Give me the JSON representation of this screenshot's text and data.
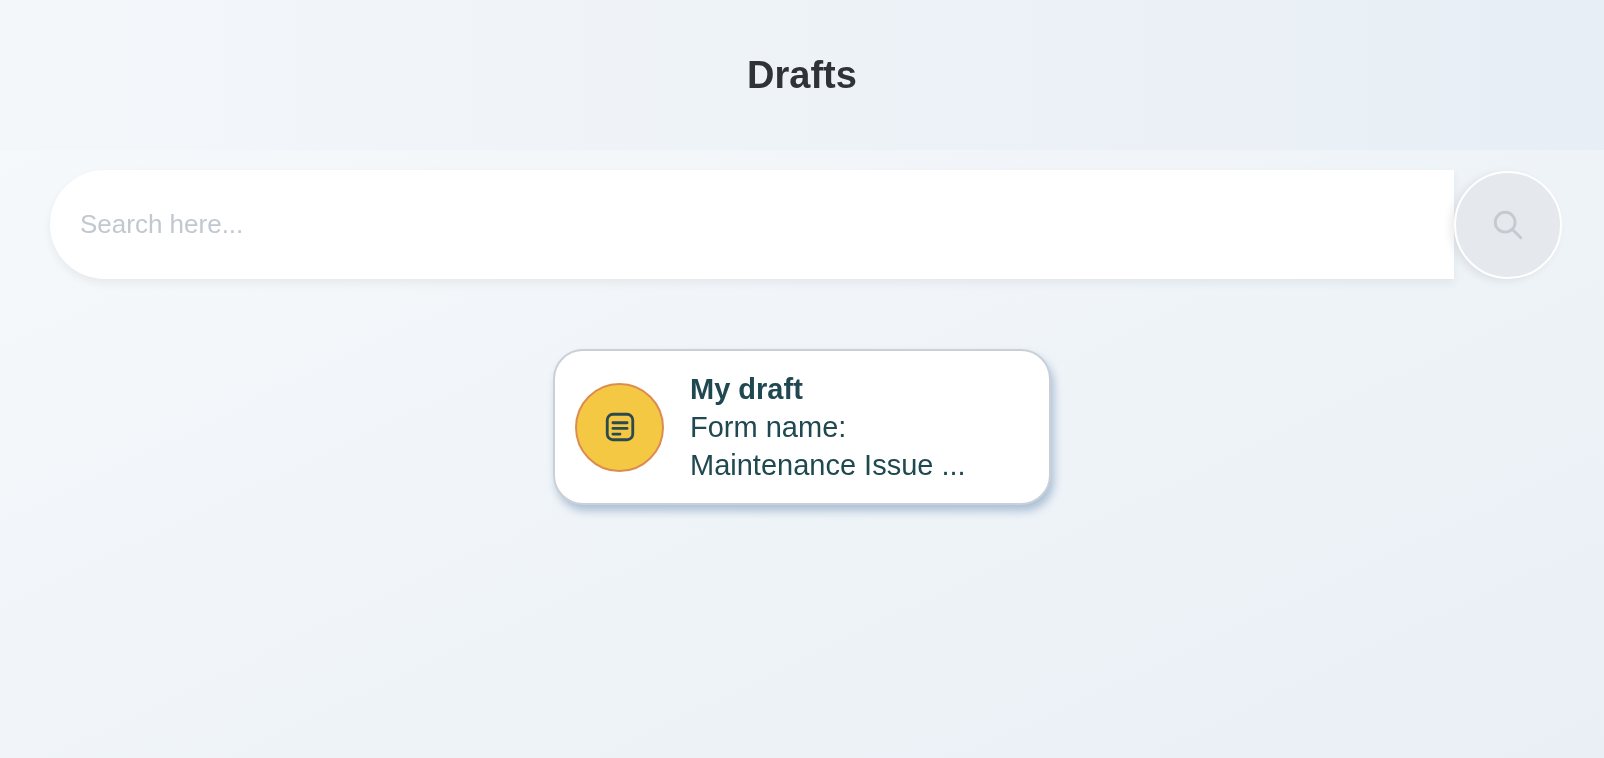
{
  "header": {
    "title": "Drafts"
  },
  "search": {
    "placeholder": "Search here..."
  },
  "drafts": [
    {
      "title": "My draft",
      "lines": [
        "Form name:",
        "Maintenance Issue ..."
      ]
    }
  ]
}
